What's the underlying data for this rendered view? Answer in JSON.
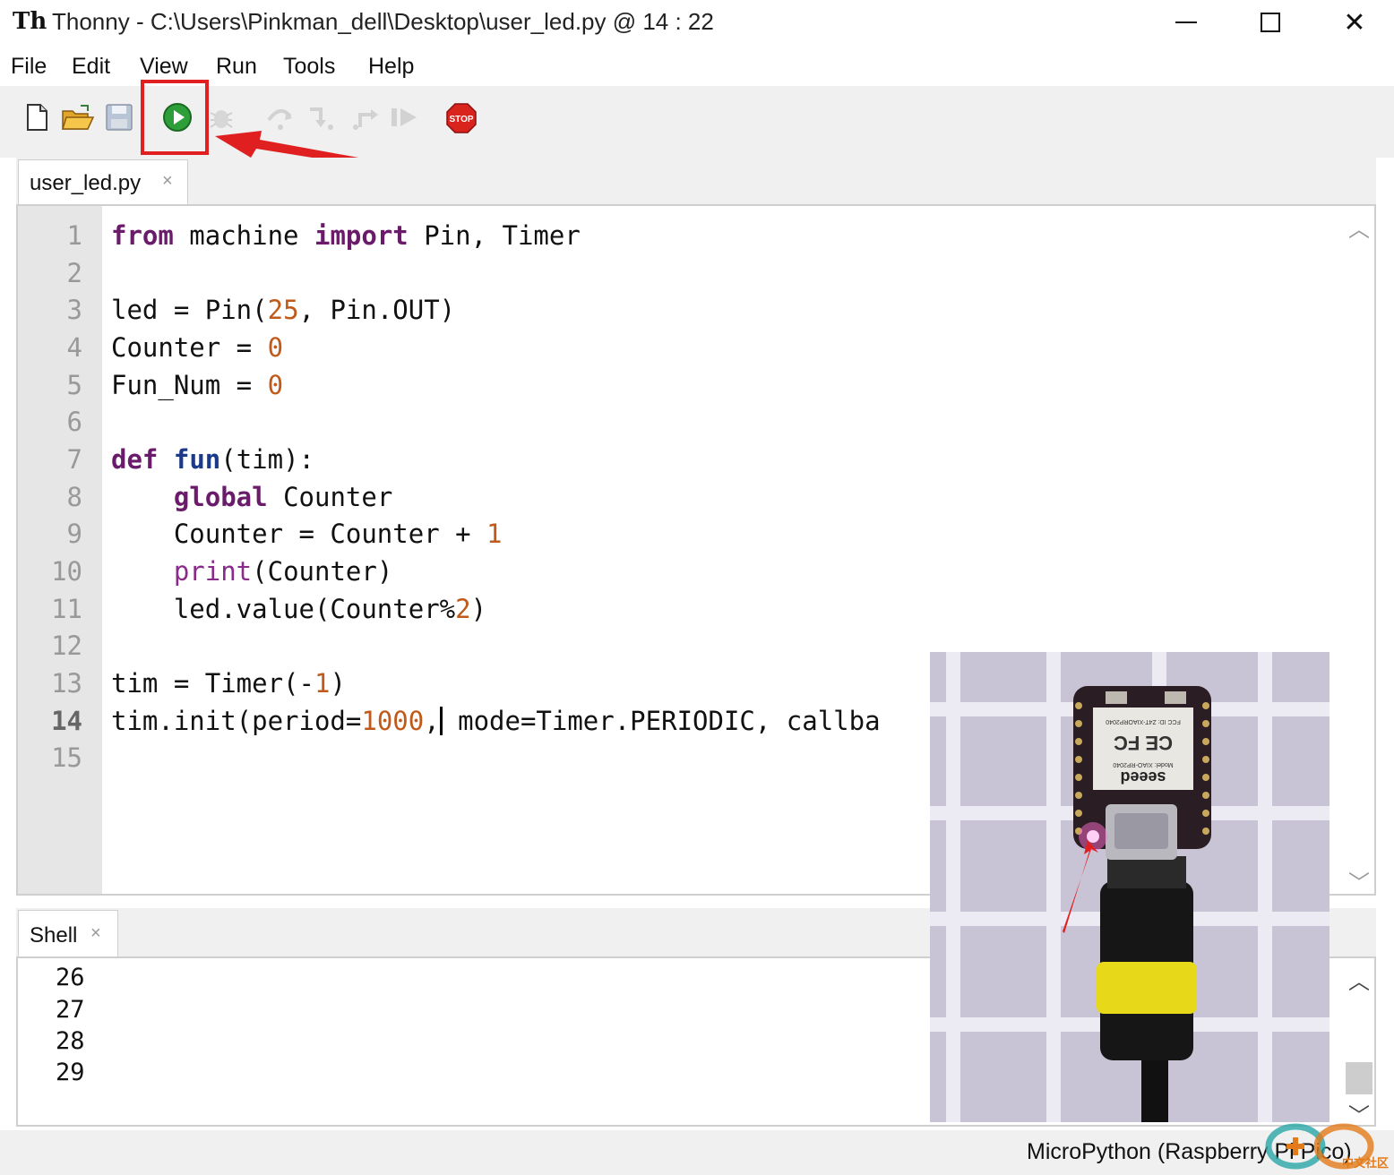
{
  "window": {
    "app_name": "Thonny",
    "title": "Thonny  -  C:\\Users\\Pinkman_dell\\Desktop\\user_led.py  @  14 : 22",
    "close_glyph": "✕"
  },
  "menu": [
    "File",
    "Edit",
    "View",
    "Run",
    "Tools",
    "Help"
  ],
  "toolbar": {
    "buttons": [
      "new-file",
      "open-file",
      "save-file",
      "run-current-script",
      "debug",
      "step-over",
      "step-into",
      "step-out",
      "resume",
      "stop"
    ],
    "stop_label": "STOP",
    "highlighted": "run-current-script"
  },
  "editor": {
    "tab": {
      "label": "user_led.py",
      "close": "×"
    },
    "line_numbers": [
      "1",
      "2",
      "3",
      "4",
      "5",
      "6",
      "7",
      "8",
      "9",
      "10",
      "11",
      "12",
      "13",
      "14",
      "15"
    ],
    "current_line": "14",
    "lines": [
      "from machine import Pin, Timer",
      "",
      "led = Pin(25, Pin.OUT)",
      "Counter = 0",
      "Fun_Num = 0",
      "",
      "def fun(tim):",
      "    global Counter",
      "    Counter = Counter + 1",
      "    print(Counter)",
      "    led.value(Counter%2)",
      "",
      "tim = Timer(-1)",
      "tim.init(period=1000, mode=Timer.PERIODIC, callba",
      ""
    ]
  },
  "shell": {
    "tab": {
      "label": "Shell",
      "close": "×"
    },
    "output": [
      "26",
      "27",
      "28",
      "29"
    ]
  },
  "status": {
    "interpreter": "MicroPython (Raspberry Pi Pico)"
  },
  "photo": {
    "board_label": "seeed",
    "model": "Model: XIAO-RP2040",
    "fcc_id": "FCC ID: Z4T-XIAORP2040",
    "marks": "CE FC"
  },
  "watermark": {
    "text": "中文社区"
  },
  "colors": {
    "keyword": "#6a1b6a",
    "function_name": "#1b3a8a",
    "builtin": "#8a2a8a",
    "number": "#c05a1a",
    "highlight_red": "#e02020",
    "run_green": "#2e9e3a",
    "stop_red": "#d9231d"
  }
}
